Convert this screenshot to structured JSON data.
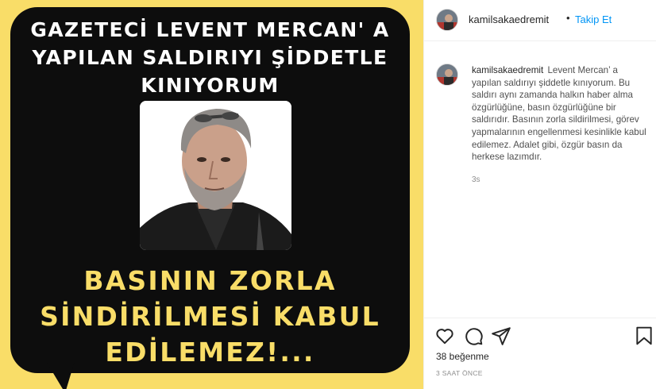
{
  "post_image": {
    "headline_lines": [
      "GAZETECİ LEVENT MERCAN' A",
      "YAPILAN SALDIRIYI ŞİDDETLE",
      "KINIYORUM"
    ],
    "slogan_lines": [
      "BASININ ZORLA",
      "SİNDİRİLMESİ KABUL",
      "EDİLEMEZ!..."
    ],
    "colors": {
      "background": "#f9dd68",
      "bubble": "#0d0d0d",
      "headline": "#ffffff",
      "slogan": "#f9dd68"
    }
  },
  "header": {
    "username": "kamilsakaedremit",
    "separator": "•",
    "follow_label": "Takip Et"
  },
  "caption": {
    "username": "kamilsakaedremit",
    "text": "Levent Mercan’ a yapılan saldırıyı şiddetle kınıyorum. Bu saldırı aynı zamanda halkın haber alma özgürlüğüne, basın özgürlüğüne bir saldırıdır. Basının zorla sildirilmesi, görev yapmalarının engellenmesi kesinlikle kabul edilemez. Adalet gibi, özgür basın da herkese lazımdır.",
    "time": "3s"
  },
  "actions": {
    "icons": [
      "heart-icon",
      "comment-icon",
      "share-icon",
      "bookmark-icon"
    ],
    "likes": "38 beğenme",
    "post_time": "3 SAAT ÖNCE"
  },
  "colors": {
    "link": "#0095f6",
    "text": "#262626",
    "muted": "#8e8e8e"
  }
}
